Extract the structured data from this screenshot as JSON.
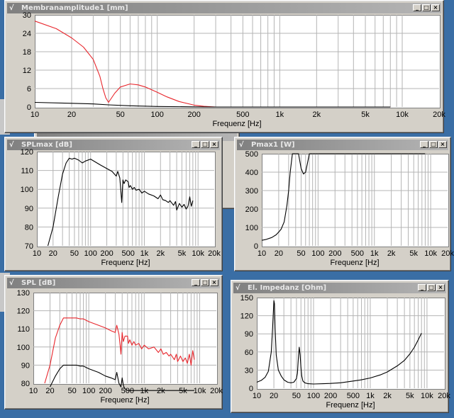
{
  "windows": {
    "membran": {
      "title": "Membranamplitude1 [mm]",
      "xlabel": "Frequenz [Hz]",
      "xticks": [
        "10",
        "20",
        "50",
        "100",
        "200",
        "500",
        "1k",
        "2k",
        "5k",
        "10k",
        "20k"
      ],
      "yticks": [
        "0",
        "6",
        "12",
        "18",
        "24",
        "30"
      ]
    },
    "splmax": {
      "title": "SPLmax [dB]",
      "xlabel": "Frequenz [Hz]",
      "xticks": [
        "10",
        "20",
        "50",
        "100",
        "200",
        "500",
        "1k",
        "2k",
        "5k",
        "10k",
        "20k"
      ],
      "yticks": [
        "70",
        "80",
        "90",
        "100",
        "110",
        "120"
      ]
    },
    "pmax": {
      "title": "Pmax1 [W]",
      "xlabel": "Frequenz [Hz]",
      "xticks": [
        "10",
        "20",
        "50",
        "100",
        "200",
        "500",
        "1k",
        "2k",
        "5k",
        "10k",
        "20k"
      ],
      "yticks": [
        "0",
        "100",
        "200",
        "300",
        "400",
        "500"
      ]
    },
    "spl": {
      "title": "SPL [dB]",
      "xlabel": "Frequenz [Hz]",
      "xticks": [
        "10",
        "20",
        "50",
        "100",
        "200",
        "500",
        "1k",
        "2k",
        "5k",
        "10k",
        "20k"
      ],
      "yticks": [
        "80",
        "90",
        "100",
        "110",
        "120",
        "130"
      ]
    },
    "impedanz": {
      "title": "El. Impedanz [Ohm]",
      "xlabel": "Frequenz [Hz]",
      "xticks": [
        "10",
        "20",
        "50",
        "100",
        "200",
        "500",
        "1k",
        "2k",
        "5k",
        "10k",
        "20k"
      ],
      "yticks": [
        "0",
        "30",
        "60",
        "90",
        "120",
        "150"
      ]
    }
  },
  "controls": {
    "minimize": "_",
    "maximize": "□",
    "close": "×",
    "logo": "√"
  },
  "colors": {
    "red": "#e8262c",
    "black": "#000000",
    "grid": "#b4b4b4"
  },
  "chart_data": [
    {
      "type": "line",
      "title": "Membranamplitude1 [mm]",
      "xlabel": "Frequenz [Hz]",
      "ylabel": "",
      "xscale": "log",
      "xlim": [
        10,
        20000
      ],
      "ylim": [
        0,
        30
      ],
      "series": [
        {
          "color": "#e8262c",
          "x": [
            10,
            15,
            20,
            25,
            30,
            34,
            36,
            38,
            40,
            45,
            50,
            60,
            70,
            80,
            100,
            120,
            150,
            200,
            240,
            300,
            500,
            8000
          ],
          "y": [
            28,
            25.5,
            22.5,
            19.5,
            15.5,
            10,
            6,
            3,
            1.5,
            4.5,
            6.5,
            7.5,
            7.2,
            6.5,
            4.8,
            3.3,
            1.8,
            0.6,
            0.2,
            0,
            0,
            0
          ]
        },
        {
          "color": "#000000",
          "x": [
            10,
            20,
            30,
            40,
            60,
            100,
            200,
            300,
            1000,
            8000
          ],
          "y": [
            1.5,
            1.2,
            1,
            0.7,
            0.4,
            0.15,
            0.05,
            0,
            0,
            0
          ]
        }
      ]
    },
    {
      "type": "line",
      "title": "SPLmax [dB]",
      "xlabel": "Frequenz [Hz]",
      "ylabel": "",
      "xscale": "log",
      "xlim": [
        10,
        20000
      ],
      "ylim": [
        70,
        120
      ],
      "series": [
        {
          "color": "#000000",
          "x": [
            16,
            20,
            25,
            30,
            35,
            40,
            45,
            50,
            60,
            70,
            80,
            100,
            150,
            200,
            250,
            300,
            320,
            350,
            370,
            380,
            400,
            420,
            450,
            500,
            520,
            550,
            600,
            650,
            700,
            800,
            900,
            1000,
            1200,
            1500,
            1800,
            2000,
            2200,
            2500,
            2800,
            3000,
            3500,
            3800,
            4000,
            4500,
            5000,
            5500,
            6000,
            6500,
            7000,
            7500,
            8000
          ],
          "y": [
            70,
            80,
            96,
            108,
            114,
            116.5,
            116,
            116.5,
            115.5,
            114,
            115,
            116,
            113,
            111,
            109.5,
            107,
            109.5,
            106,
            97,
            93,
            105,
            103,
            105,
            104,
            101,
            102,
            100,
            101,
            99.5,
            100,
            98,
            99,
            97.5,
            96.5,
            95,
            97,
            94.5,
            94,
            93,
            94,
            91.5,
            93.5,
            89,
            92.5,
            90.5,
            92,
            89.5,
            91,
            96,
            91,
            94
          ]
        }
      ]
    },
    {
      "type": "line",
      "title": "Pmax1 [W]",
      "xlabel": "Frequenz [Hz]",
      "ylabel": "",
      "xscale": "log",
      "xlim": [
        10,
        20000
      ],
      "ylim": [
        0,
        500
      ],
      "series": [
        {
          "color": "#000000",
          "x": [
            10,
            12,
            15,
            18,
            20,
            22,
            25,
            28,
            30,
            32,
            35,
            38,
            40,
            45,
            50,
            55,
            60,
            65,
            70,
            80,
            100,
            200,
            1000,
            8000
          ],
          "y": [
            30,
            35,
            45,
            60,
            75,
            90,
            130,
            220,
            300,
            400,
            500,
            500,
            500,
            500,
            420,
            390,
            400,
            450,
            500,
            500,
            500,
            500,
            500,
            500
          ]
        }
      ]
    },
    {
      "type": "line",
      "title": "SPL [dB]",
      "xlabel": "Frequenz [Hz]",
      "ylabel": "",
      "xscale": "log",
      "xlim": [
        10,
        20000
      ],
      "ylim": [
        80,
        130
      ],
      "series": [
        {
          "color": "#e8262c",
          "x": [
            16,
            20,
            25,
            30,
            35,
            40,
            50,
            60,
            70,
            80,
            100,
            150,
            200,
            250,
            300,
            320,
            350,
            370,
            380,
            400,
            420,
            450,
            500,
            520,
            550,
            600,
            650,
            700,
            800,
            900,
            1000,
            1200,
            1500,
            1800,
            2000,
            2200,
            2500,
            2800,
            3000,
            3500,
            3800,
            4000,
            4500,
            5000,
            5500,
            6000,
            6500,
            7000,
            7500,
            8000
          ],
          "y": [
            80,
            90,
            105,
            112,
            116,
            116,
            116,
            116,
            115.5,
            115.5,
            114,
            112,
            110.5,
            109,
            108,
            112,
            107,
            100,
            96,
            108,
            103,
            106,
            106,
            102,
            104,
            101,
            103,
            101,
            102,
            99,
            101,
            99,
            100,
            97,
            99,
            96,
            97,
            95,
            96,
            93,
            96,
            92,
            95,
            92,
            94,
            91,
            96,
            90,
            98,
            93
          ]
        },
        {
          "color": "#000000",
          "x": [
            20,
            25,
            30,
            35,
            40,
            50,
            60,
            70,
            80,
            100,
            150,
            200,
            250,
            300,
            320,
            350,
            380,
            400,
            420,
            430,
            450,
            500,
            600,
            1000,
            8000
          ],
          "y": [
            78,
            84,
            88,
            90,
            90,
            90,
            90,
            89.5,
            89.5,
            88,
            86,
            84,
            83,
            82,
            86,
            80,
            78,
            83,
            79,
            78,
            77,
            76,
            76,
            76,
            76
          ]
        }
      ]
    },
    {
      "type": "line",
      "title": "El. Impedanz [Ohm]",
      "xlabel": "Frequenz [Hz]",
      "ylabel": "",
      "xscale": "log",
      "xlim": [
        10,
        20000
      ],
      "ylim": [
        0,
        150
      ],
      "series": [
        {
          "color": "#000000",
          "x": [
            10,
            12,
            14,
            16,
            18,
            19,
            20,
            20.5,
            21,
            22,
            24,
            27,
            30,
            35,
            40,
            45,
            50,
            52,
            54,
            56,
            58,
            60,
            62,
            65,
            70,
            80,
            100,
            150,
            200,
            300,
            500,
            700,
            1000,
            1500,
            2000,
            3000,
            4000,
            5000,
            6000,
            7000,
            8000
          ],
          "y": [
            10,
            13,
            18,
            28,
            60,
            100,
            145,
            140,
            100,
            55,
            30,
            20,
            14,
            10,
            9,
            10,
            16,
            25,
            50,
            68,
            55,
            35,
            20,
            12,
            9,
            7.5,
            7,
            7.5,
            8,
            9,
            12,
            14,
            17,
            22,
            27,
            37,
            46,
            57,
            68,
            80,
            91
          ]
        }
      ]
    }
  ]
}
